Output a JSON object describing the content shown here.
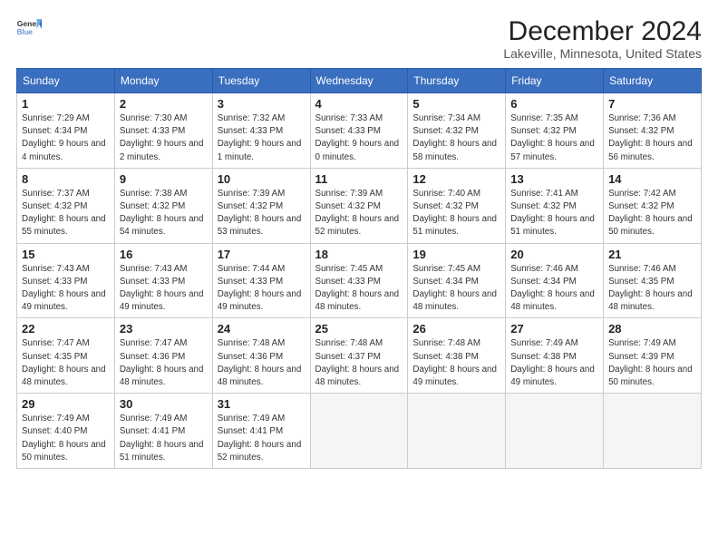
{
  "header": {
    "logo_line1": "General",
    "logo_line2": "Blue",
    "month_title": "December 2024",
    "location": "Lakeville, Minnesota, United States"
  },
  "weekdays": [
    "Sunday",
    "Monday",
    "Tuesday",
    "Wednesday",
    "Thursday",
    "Friday",
    "Saturday"
  ],
  "weeks": [
    [
      {
        "day": "1",
        "sunrise": "7:29 AM",
        "sunset": "4:34 PM",
        "daylight": "9 hours and 4 minutes."
      },
      {
        "day": "2",
        "sunrise": "7:30 AM",
        "sunset": "4:33 PM",
        "daylight": "9 hours and 2 minutes."
      },
      {
        "day": "3",
        "sunrise": "7:32 AM",
        "sunset": "4:33 PM",
        "daylight": "9 hours and 1 minute."
      },
      {
        "day": "4",
        "sunrise": "7:33 AM",
        "sunset": "4:33 PM",
        "daylight": "9 hours and 0 minutes."
      },
      {
        "day": "5",
        "sunrise": "7:34 AM",
        "sunset": "4:32 PM",
        "daylight": "8 hours and 58 minutes."
      },
      {
        "day": "6",
        "sunrise": "7:35 AM",
        "sunset": "4:32 PM",
        "daylight": "8 hours and 57 minutes."
      },
      {
        "day": "7",
        "sunrise": "7:36 AM",
        "sunset": "4:32 PM",
        "daylight": "8 hours and 56 minutes."
      }
    ],
    [
      {
        "day": "8",
        "sunrise": "7:37 AM",
        "sunset": "4:32 PM",
        "daylight": "8 hours and 55 minutes."
      },
      {
        "day": "9",
        "sunrise": "7:38 AM",
        "sunset": "4:32 PM",
        "daylight": "8 hours and 54 minutes."
      },
      {
        "day": "10",
        "sunrise": "7:39 AM",
        "sunset": "4:32 PM",
        "daylight": "8 hours and 53 minutes."
      },
      {
        "day": "11",
        "sunrise": "7:39 AM",
        "sunset": "4:32 PM",
        "daylight": "8 hours and 52 minutes."
      },
      {
        "day": "12",
        "sunrise": "7:40 AM",
        "sunset": "4:32 PM",
        "daylight": "8 hours and 51 minutes."
      },
      {
        "day": "13",
        "sunrise": "7:41 AM",
        "sunset": "4:32 PM",
        "daylight": "8 hours and 51 minutes."
      },
      {
        "day": "14",
        "sunrise": "7:42 AM",
        "sunset": "4:32 PM",
        "daylight": "8 hours and 50 minutes."
      }
    ],
    [
      {
        "day": "15",
        "sunrise": "7:43 AM",
        "sunset": "4:33 PM",
        "daylight": "8 hours and 49 minutes."
      },
      {
        "day": "16",
        "sunrise": "7:43 AM",
        "sunset": "4:33 PM",
        "daylight": "8 hours and 49 minutes."
      },
      {
        "day": "17",
        "sunrise": "7:44 AM",
        "sunset": "4:33 PM",
        "daylight": "8 hours and 49 minutes."
      },
      {
        "day": "18",
        "sunrise": "7:45 AM",
        "sunset": "4:33 PM",
        "daylight": "8 hours and 48 minutes."
      },
      {
        "day": "19",
        "sunrise": "7:45 AM",
        "sunset": "4:34 PM",
        "daylight": "8 hours and 48 minutes."
      },
      {
        "day": "20",
        "sunrise": "7:46 AM",
        "sunset": "4:34 PM",
        "daylight": "8 hours and 48 minutes."
      },
      {
        "day": "21",
        "sunrise": "7:46 AM",
        "sunset": "4:35 PM",
        "daylight": "8 hours and 48 minutes."
      }
    ],
    [
      {
        "day": "22",
        "sunrise": "7:47 AM",
        "sunset": "4:35 PM",
        "daylight": "8 hours and 48 minutes."
      },
      {
        "day": "23",
        "sunrise": "7:47 AM",
        "sunset": "4:36 PM",
        "daylight": "8 hours and 48 minutes."
      },
      {
        "day": "24",
        "sunrise": "7:48 AM",
        "sunset": "4:36 PM",
        "daylight": "8 hours and 48 minutes."
      },
      {
        "day": "25",
        "sunrise": "7:48 AM",
        "sunset": "4:37 PM",
        "daylight": "8 hours and 48 minutes."
      },
      {
        "day": "26",
        "sunrise": "7:48 AM",
        "sunset": "4:38 PM",
        "daylight": "8 hours and 49 minutes."
      },
      {
        "day": "27",
        "sunrise": "7:49 AM",
        "sunset": "4:38 PM",
        "daylight": "8 hours and 49 minutes."
      },
      {
        "day": "28",
        "sunrise": "7:49 AM",
        "sunset": "4:39 PM",
        "daylight": "8 hours and 50 minutes."
      }
    ],
    [
      {
        "day": "29",
        "sunrise": "7:49 AM",
        "sunset": "4:40 PM",
        "daylight": "8 hours and 50 minutes."
      },
      {
        "day": "30",
        "sunrise": "7:49 AM",
        "sunset": "4:41 PM",
        "daylight": "8 hours and 51 minutes."
      },
      {
        "day": "31",
        "sunrise": "7:49 AM",
        "sunset": "4:41 PM",
        "daylight": "8 hours and 52 minutes."
      },
      null,
      null,
      null,
      null
    ]
  ],
  "labels": {
    "sunrise": "Sunrise:",
    "sunset": "Sunset:",
    "daylight": "Daylight:"
  }
}
